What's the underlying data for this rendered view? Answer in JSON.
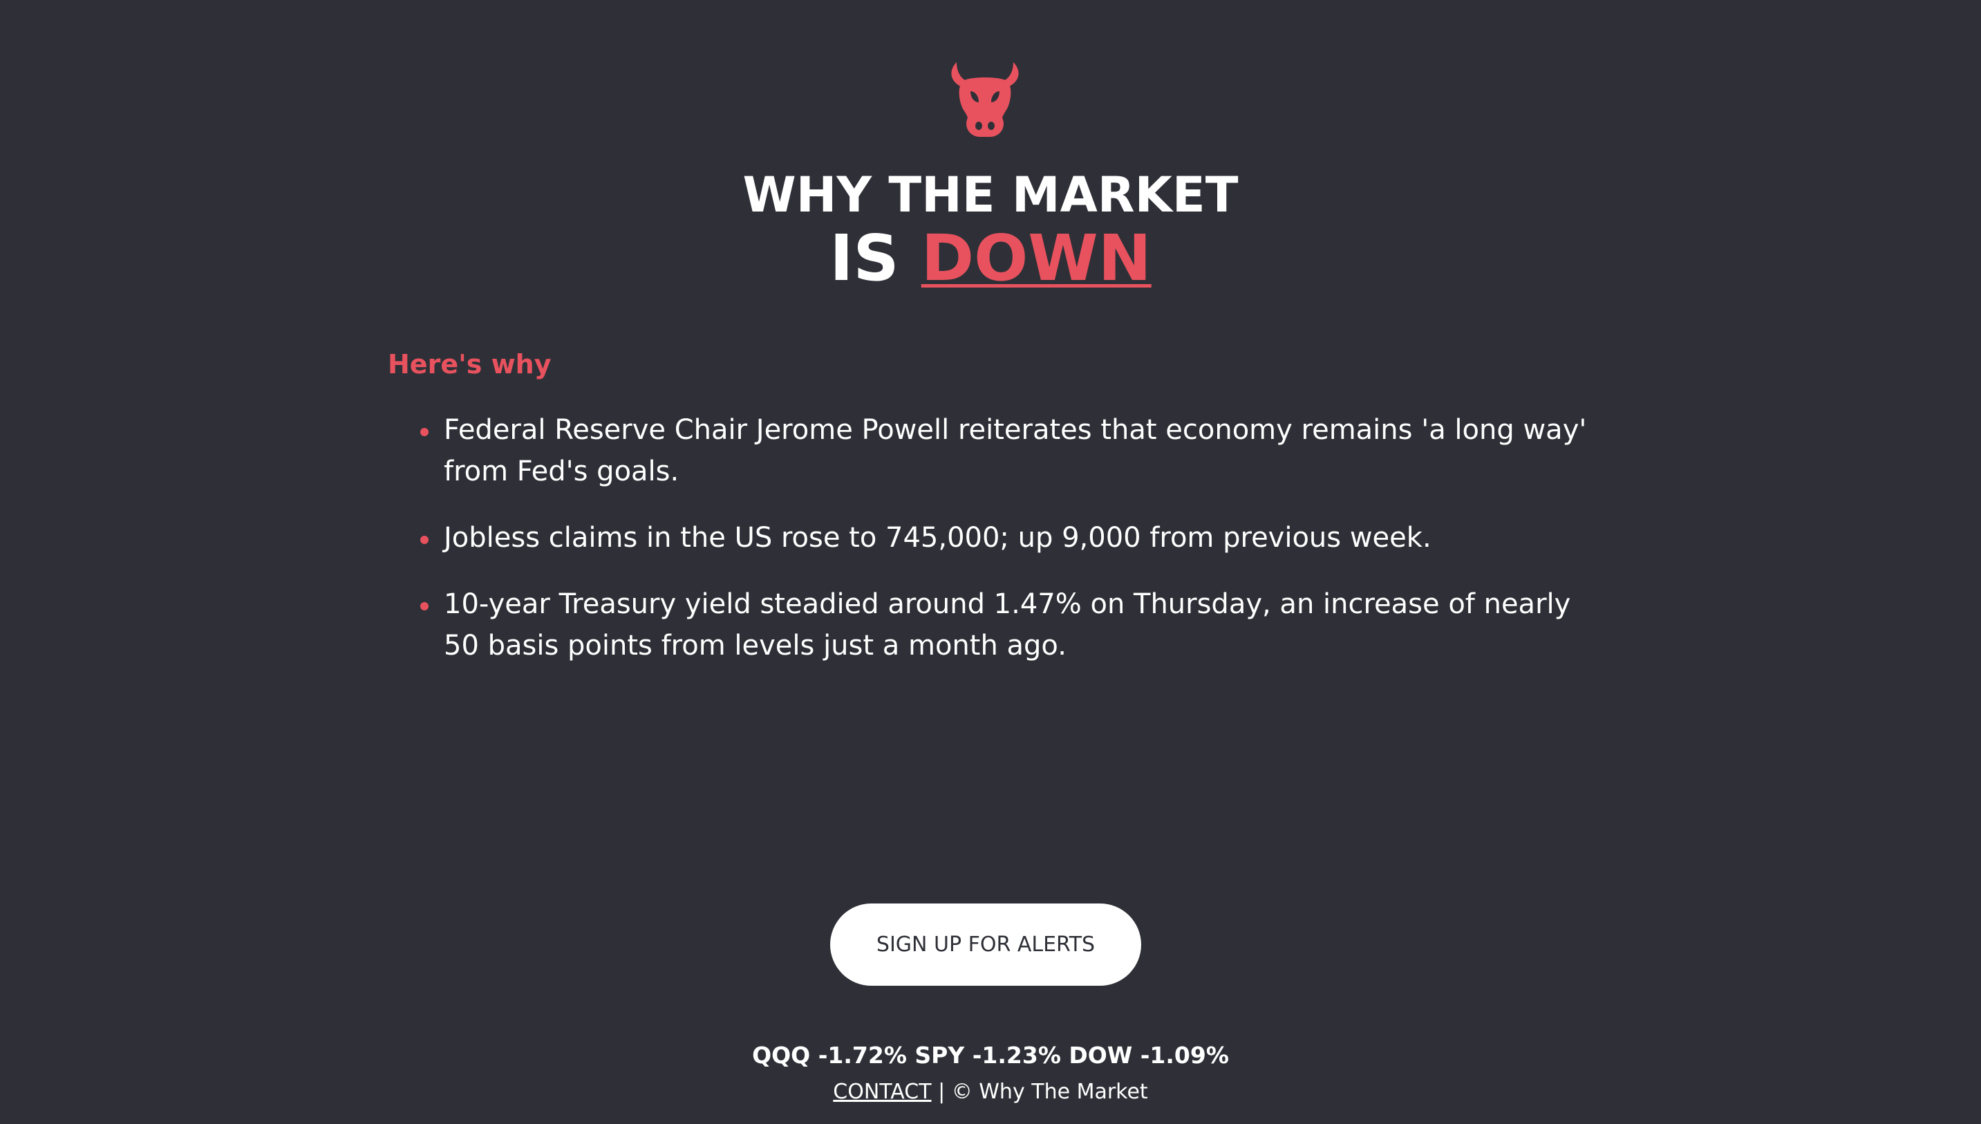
{
  "colors": {
    "background": "#2f3037",
    "accent": "#e8525e",
    "text": "#ffffff"
  },
  "logo": {
    "icon": "bull-head-icon"
  },
  "title": {
    "line1": "WHY THE MARKET",
    "line2_prefix": "IS",
    "line2_highlight": "DOWN"
  },
  "reasons": {
    "heading": "Here's why",
    "items": [
      "Federal Reserve Chair Jerome Powell reiterates that economy remains 'a long way' from Fed's goals.",
      "Jobless claims in the US rose to 745,000; up 9,000 from previous week.",
      "10-year Treasury yield steadied around 1.47% on Thursday, an increase of nearly 50 basis points from levels just a month ago."
    ]
  },
  "cta": {
    "signup_label": "SIGN UP FOR ALERTS"
  },
  "ticker": {
    "text": "QQQ -1.72% SPY -1.23% DOW -1.09%"
  },
  "footer": {
    "contact_label": "CONTACT",
    "separator": " | ",
    "copyright": "© Why The Market"
  }
}
